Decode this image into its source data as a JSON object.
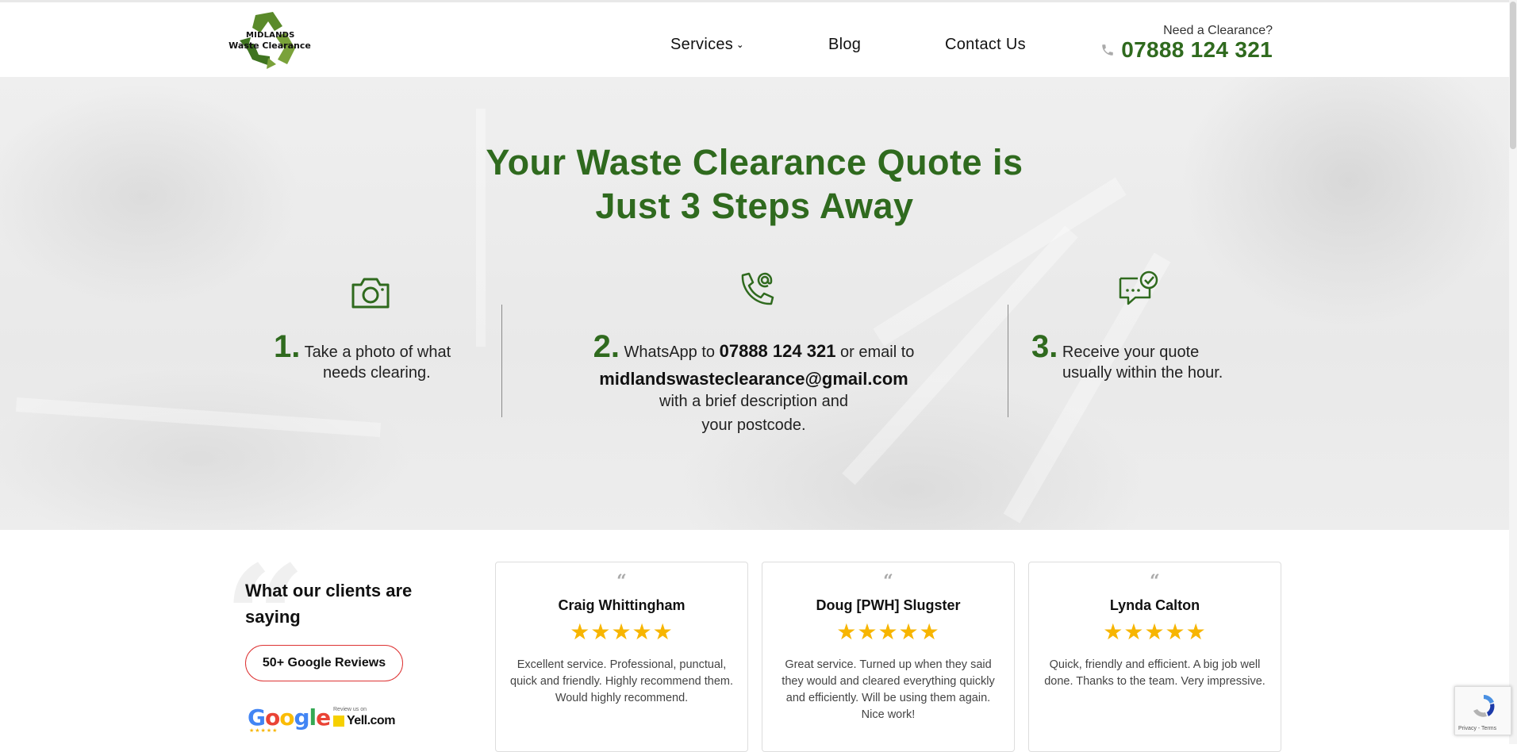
{
  "header": {
    "logo_line1": "MIDLANDS",
    "logo_line2": "Waste Clearance",
    "nav": [
      {
        "label": "Services",
        "has_dropdown": true
      },
      {
        "label": "Blog"
      },
      {
        "label": "Contact Us"
      }
    ],
    "cta_label": "Need a Clearance?",
    "phone": "07888 124 321"
  },
  "hero": {
    "title_line1": "Your Waste Clearance Quote is",
    "title_line2": "Just 3 Steps Away",
    "steps": [
      {
        "number": "1.",
        "text_a": "Take a photo of what",
        "text_b": "needs clearing.",
        "icon": "camera-icon"
      },
      {
        "number": "2.",
        "text_pre": "WhatsApp to",
        "phone": "07888 124 321",
        "text_mid": "or email to",
        "email": "midlandswasteclearance@gmail.com",
        "text_b": "with a brief description and",
        "text_c": "your postcode.",
        "icon": "phone-at-icon"
      },
      {
        "number": "3.",
        "text_a": "Receive your quote",
        "text_b": "usually within the hour.",
        "icon": "chat-check-icon"
      }
    ]
  },
  "reviews": {
    "heading": "What our clients are saying",
    "google_button": "50+ Google Reviews",
    "google_logo": "Google",
    "yell_caption": "Review us on",
    "yell_logo": "Yell.com",
    "cards": [
      {
        "name": "Craig Whittingham",
        "rating": 5,
        "stars": "★★★★★",
        "text": "Excellent service. Professional, punctual, quick and friendly. Highly recommend them. Would highly recommend."
      },
      {
        "name": "Doug [PWH] Slugster",
        "rating": 5,
        "stars": "★★★★★",
        "text": "Great service. Turned up when they said they would and cleared everything quickly and efficiently. Will be using them again. Nice work!"
      },
      {
        "name": "Lynda Calton",
        "rating": 5,
        "stars": "★★★★★",
        "text": "Quick, friendly and efficient. A big job well done. Thanks to the team. Very impressive."
      }
    ]
  },
  "recaptcha": {
    "text": "Privacy - Terms"
  },
  "colors": {
    "brand_green": "#2f6a1e",
    "star": "#f7b500",
    "button_border": "#dd3333"
  }
}
